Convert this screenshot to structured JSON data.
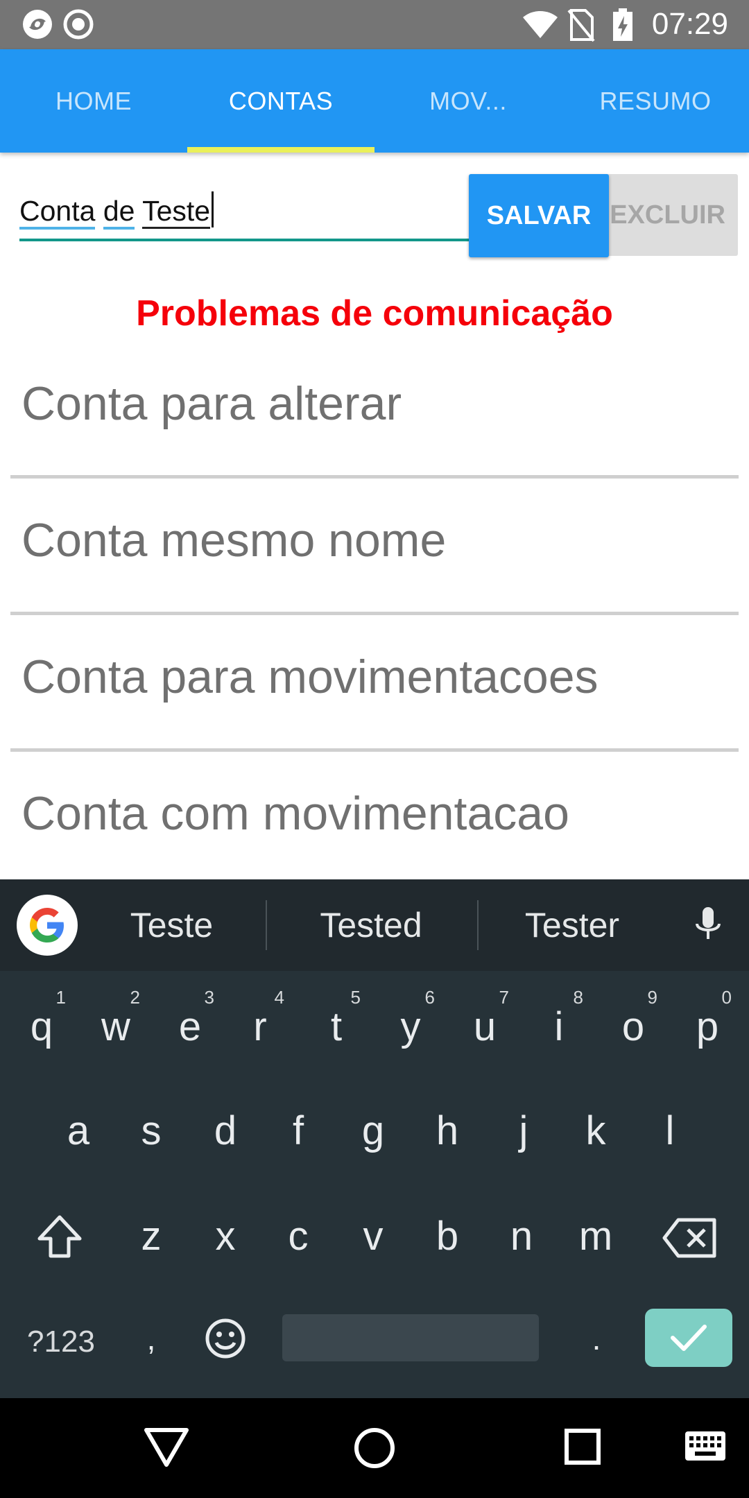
{
  "status_bar": {
    "time": "07:29"
  },
  "tabs": [
    {
      "label": "HOME"
    },
    {
      "label": "CONTAS"
    },
    {
      "label": "MOV..."
    },
    {
      "label": "RESUMO"
    }
  ],
  "form": {
    "input_value_parts": [
      "Conta",
      " ",
      "de",
      " ",
      "Teste"
    ],
    "save_label": "SALVAR",
    "delete_label": "EXCLUIR"
  },
  "error_message": "Problemas de comunicação",
  "accounts": [
    {
      "name": "Conta para alterar"
    },
    {
      "name": "Conta mesmo nome"
    },
    {
      "name": "Conta para movimentacoes"
    },
    {
      "name": "Conta com movimentacao"
    }
  ],
  "keyboard": {
    "suggestions": [
      "Teste",
      "Tested",
      "Tester"
    ],
    "row1": [
      {
        "key": "q",
        "alt": "1"
      },
      {
        "key": "w",
        "alt": "2"
      },
      {
        "key": "e",
        "alt": "3"
      },
      {
        "key": "r",
        "alt": "4"
      },
      {
        "key": "t",
        "alt": "5"
      },
      {
        "key": "y",
        "alt": "6"
      },
      {
        "key": "u",
        "alt": "7"
      },
      {
        "key": "i",
        "alt": "8"
      },
      {
        "key": "o",
        "alt": "9"
      },
      {
        "key": "p",
        "alt": "0"
      }
    ],
    "row2": [
      "a",
      "s",
      "d",
      "f",
      "g",
      "h",
      "j",
      "k",
      "l"
    ],
    "row3": [
      "z",
      "x",
      "c",
      "v",
      "b",
      "n",
      "m"
    ],
    "num_label": "?123",
    "comma": ",",
    "period": "."
  },
  "colors": {
    "primary": "#2196F3",
    "tab_indicator": "#EAF05A",
    "error": "#F5000A",
    "keyboard_bg": "#263238",
    "enter_key": "#7ECFC4"
  }
}
